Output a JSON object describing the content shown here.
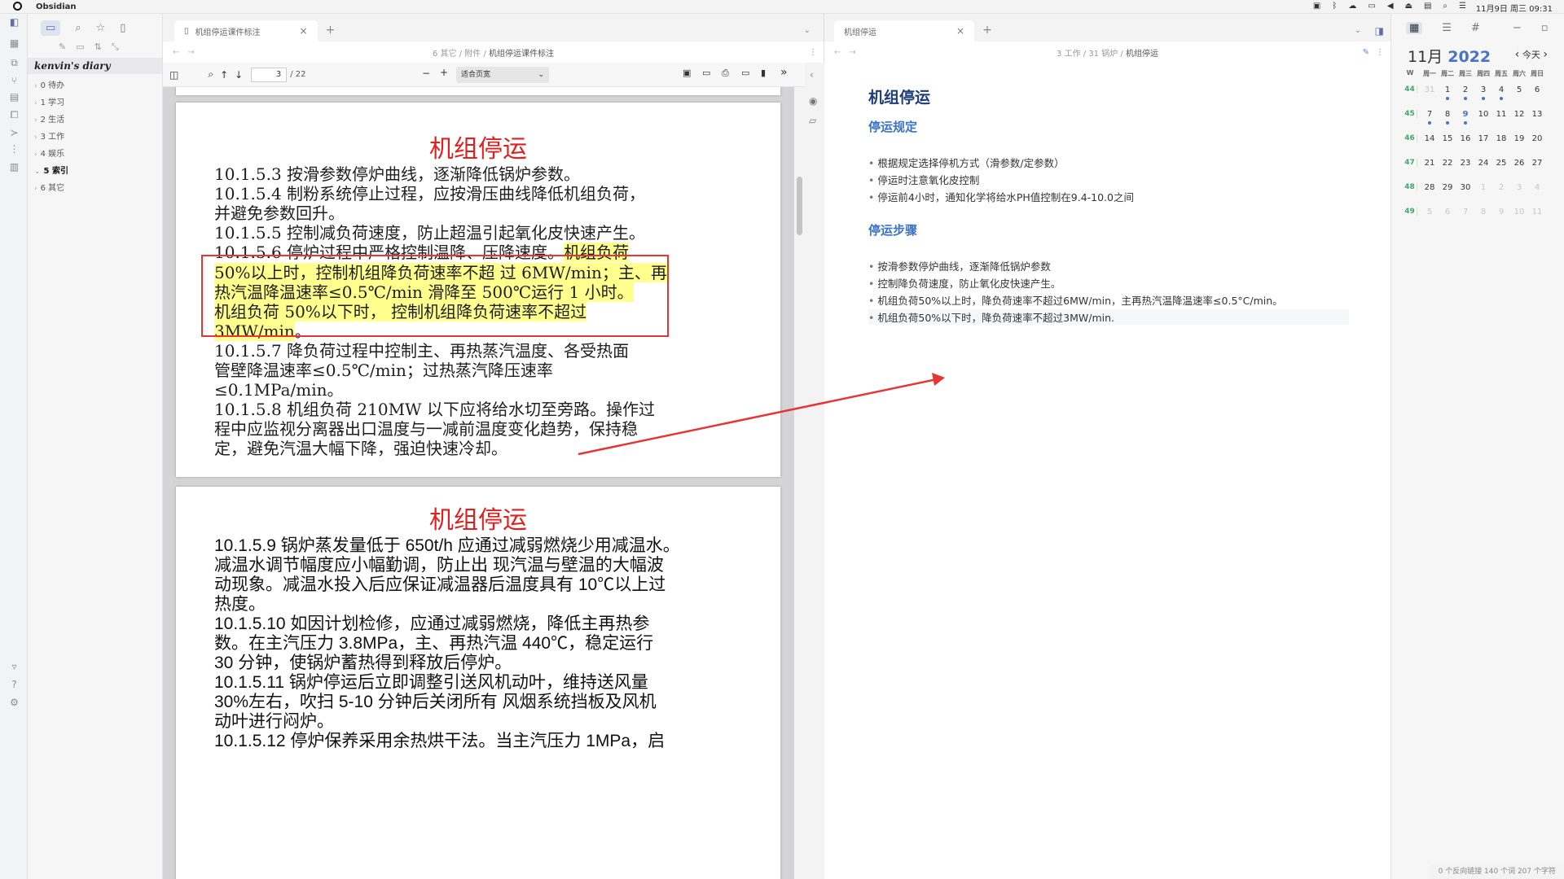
{
  "system": {
    "app_name": "Obsidian",
    "clock": "11月9日 周三 09:31"
  },
  "explorer": {
    "vault_name": "kenvin's diary",
    "folders": [
      "0 待办",
      "1 学习",
      "2 生活",
      "3 工作",
      "4 娱乐",
      "5 索引",
      "6 其它"
    ],
    "active_folder": "5 索引"
  },
  "left_pane": {
    "tab_title": "机组停运课件标注",
    "breadcrumb_prefix": "6 其它 / 附件 / ",
    "breadcrumb_current": "机组停运课件标注",
    "page_number": "3",
    "page_total": "/ 22",
    "zoom_select": "适合页宽",
    "page1": {
      "title": "机组停运",
      "lines": [
        "10.1.5.3 按滑参数停炉曲线，逐渐降低锅炉参数。",
        "10.1.5.4 制粉系统停止过程，应按滑压曲线降低机组负荷，",
        "并避免参数回升。",
        "10.1.5.5 控制减负荷速度，防止超温引起氧化皮快速产生。",
        "10.1.5.6 停炉过程中严格控制温降、压降速度。",
        "机组负荷",
        "50%以上时，控制机组降负荷速率不超 过 6MW/min；主、再",
        "热汽温降温速率≤0.5℃/min 滑降至 500℃运行 1 小时。",
        "机组负荷 50%以下时， 控制机组降负荷速率不超过",
        "3MW/min",
        "。",
        "10.1.5.7 降负荷过程中控制主、再热蒸汽温度、各受热面",
        "管壁降温速率≤0.5℃/min；过热蒸汽降压速率",
        "≤0.1MPa/min。",
        "10.1.5.8 机组负荷 210MW 以下应将给水切至旁路。操作过",
        "程中应监视分离器出口温度与一减前温度变化趋势，保持稳",
        "定，避免汽温大幅下降，强迫快速冷却。"
      ]
    },
    "page2": {
      "title": "机组停运",
      "lines": [
        "10.1.5.9 锅炉蒸发量低于 650t/h 应通过减弱燃烧少用减温水。",
        "减温水调节幅度应小幅勤调，防止出 现汽温与壁温的大幅波",
        "动现象。减温水投入后应保证减温器后温度具有 10℃以上过",
        "热度。",
        "10.1.5.10 如因计划检修，应通过减弱燃烧，降低主再热参",
        "数。在主汽压力 3.8MPa，主、再热汽温 440℃，稳定运行",
        "30 分钟，使锅炉蓄热得到释放后停炉。",
        "10.1.5.11 锅炉停运后立即调整引送风机动叶，维持送风量",
        "30%左右，吹扫 5-10 分钟后关闭所有 风烟系统挡板及风机",
        "动叶进行闷炉。",
        "10.1.5.12 停炉保养采用余热烘干法。当主汽压力 1MPa，启"
      ]
    }
  },
  "right_pane": {
    "tab_title": "机组停运",
    "breadcrumb_prefix": "3 工作 / 31 锅炉 / ",
    "breadcrumb_current": "机组停运",
    "h1": "机组停运",
    "section1": {
      "heading": "停运规定",
      "items": [
        "根据规定选择停机方式（滑参数/定参数）",
        "停运时注意氧化皮控制",
        "停运前4小时，通知化学将给水PH值控制在9.4-10.0之间"
      ]
    },
    "section2": {
      "heading": "停运步骤",
      "items": [
        "按滑参数停炉曲线，逐渐降低锅炉参数",
        "控制降负荷速度，防止氧化皮快速产生。",
        "机组负荷50%以上时，降负荷速率不超过6MW/min，主再热汽温降温速率≤0.5°C/min。",
        "机组负荷50%以下时，降负荷速率不超过3MW/min."
      ]
    }
  },
  "calendar": {
    "month": "11月",
    "year": "2022",
    "today_label": "今天",
    "week_col": "W",
    "weekdays": [
      "周一",
      "周二",
      "周三",
      "周四",
      "周五",
      "周六",
      "周日"
    ],
    "weeks": [
      {
        "wk": "44",
        "days": [
          "31",
          "1",
          "2",
          "3",
          "4",
          "5",
          "6"
        ]
      },
      {
        "wk": "45",
        "days": [
          "7",
          "8",
          "9",
          "10",
          "11",
          "12",
          "13"
        ]
      },
      {
        "wk": "46",
        "days": [
          "14",
          "15",
          "16",
          "17",
          "18",
          "19",
          "20"
        ]
      },
      {
        "wk": "47",
        "days": [
          "21",
          "22",
          "23",
          "24",
          "25",
          "26",
          "27"
        ]
      },
      {
        "wk": "48",
        "days": [
          "28",
          "29",
          "30",
          "1",
          "2",
          "3",
          "4"
        ]
      },
      {
        "wk": "49",
        "days": [
          "5",
          "6",
          "7",
          "8",
          "9",
          "10",
          "11"
        ]
      }
    ],
    "accent_color": "#4a72c4"
  },
  "status_bar": "0 个反向链接   140 个词   207 个字符",
  "annotation": {
    "box_color": "#e53535",
    "highlight_color": "#ffff8d"
  }
}
